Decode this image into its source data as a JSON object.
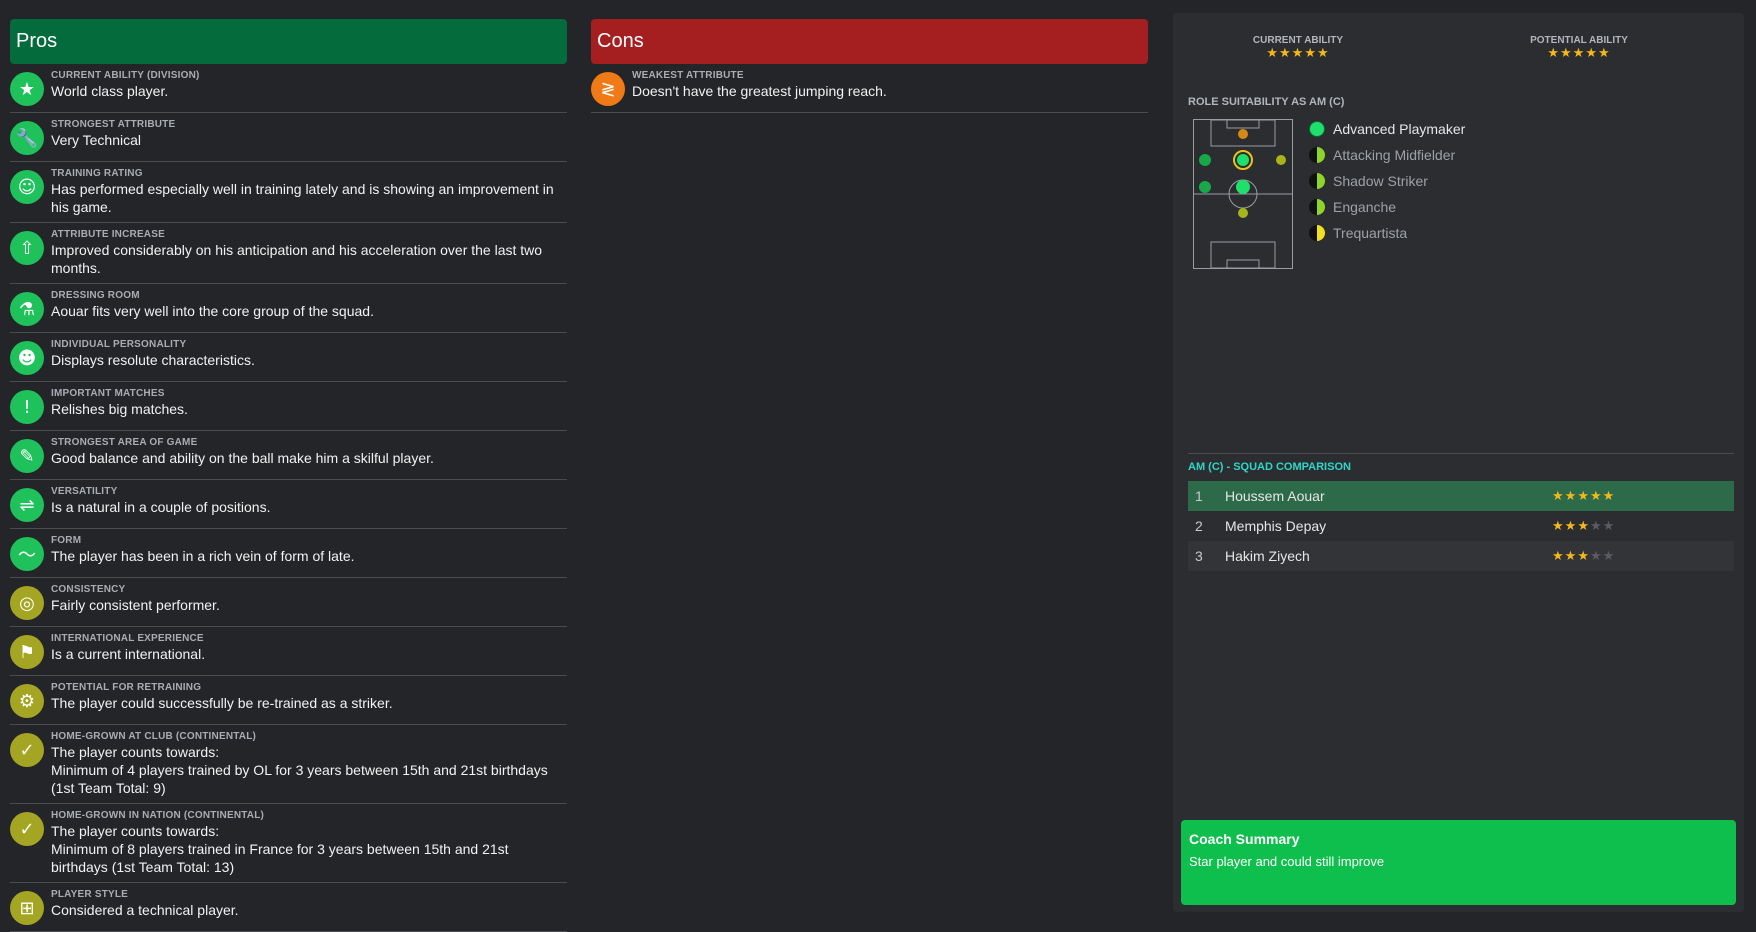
{
  "pros": {
    "title": "Pros",
    "items": [
      {
        "title": "CURRENT ABILITY (DIVISION)",
        "desc": "World class player."
      },
      {
        "title": "STRONGEST ATTRIBUTE",
        "desc": "Very Technical"
      },
      {
        "title": "TRAINING RATING",
        "desc": "Has performed especially well in training lately and is showing an improvement in his game."
      },
      {
        "title": "ATTRIBUTE INCREASE",
        "desc": "Improved considerably on his anticipation and his acceleration over the last two months."
      },
      {
        "title": "DRESSING ROOM",
        "desc": "Aouar fits very well into the core group of the squad."
      },
      {
        "title": "INDIVIDUAL PERSONALITY",
        "desc": "Displays resolute characteristics."
      },
      {
        "title": "IMPORTANT MATCHES",
        "desc": "Relishes big matches."
      },
      {
        "title": "STRONGEST AREA OF GAME",
        "desc": "Good balance and ability on the ball make him a skilful player."
      },
      {
        "title": "VERSATILITY",
        "desc": "Is a natural in a couple of positions."
      },
      {
        "title": "FORM",
        "desc": "The player has been in a rich vein of form of late."
      },
      {
        "title": "CONSISTENCY",
        "desc": "Fairly consistent performer."
      },
      {
        "title": "INTERNATIONAL EXPERIENCE",
        "desc": "Is a current international."
      },
      {
        "title": "POTENTIAL FOR RETRAINING",
        "desc": "The player could successfully be re-trained as a striker."
      },
      {
        "title": "HOME-GROWN AT CLUB (CONTINENTAL)",
        "desc": "The player counts towards:\nMinimum of 4 players trained by OL for 3 years between 15th and 21st birthdays (1st Team Total: 9)"
      },
      {
        "title": "HOME-GROWN IN NATION (CONTINENTAL)",
        "desc": "The player counts towards:\nMinimum of 8 players trained in France for 3 years between 15th and 21st birthdays (1st Team Total: 13)"
      },
      {
        "title": "PLAYER STYLE",
        "desc": "Considered a technical player."
      }
    ]
  },
  "cons": {
    "title": "Cons",
    "items": [
      {
        "title": "WEAKEST ATTRIBUTE",
        "desc": "Doesn't have the greatest jumping reach."
      }
    ]
  },
  "abilities": {
    "current_label": "CURRENT ABILITY",
    "current_stars": 5,
    "potential_label": "POTENTIAL ABILITY",
    "potential_stars": 5
  },
  "role_suitability": {
    "label": "ROLE SUITABILITY AS AM (C)",
    "roles": [
      {
        "name": "Advanced Playmaker",
        "rating": "full"
      },
      {
        "name": "Attacking Midfielder",
        "rating": "half-green"
      },
      {
        "name": "Shadow Striker",
        "rating": "half-green"
      },
      {
        "name": "Enganche",
        "rating": "half-green"
      },
      {
        "name": "Trequartista",
        "rating": "half-yellow"
      }
    ]
  },
  "squad_comparison": {
    "label": "AM (C) - SQUAD COMPARISON",
    "rows": [
      {
        "rank": "1",
        "name": "Houssem Aouar",
        "stars": 5
      },
      {
        "rank": "2",
        "name": "Memphis Depay",
        "stars": 3
      },
      {
        "rank": "3",
        "name": "Hakim Ziyech",
        "stars": 3
      }
    ]
  },
  "coach_summary": {
    "title": "Coach Summary",
    "text": "Star player and could still improve"
  },
  "colors": {
    "pros_header": "#046b3c",
    "cons_header": "#a51e20",
    "coach_bg": "#0fbf4d",
    "star": "#f3b81b"
  },
  "icons": {
    "pros": [
      "star-icon",
      "wrench-icon",
      "training-smile-icon",
      "training-arrow-icon",
      "flask-icon",
      "head-icon",
      "exclamation-ball-icon",
      "boot-icon",
      "handshake-icon",
      "trend-line-icon",
      "target-icon",
      "flag-icon",
      "retrain-gear-icon",
      "document-check-icon",
      "document-check-icon",
      "pitch-icon"
    ],
    "cons": [
      "spring-icon"
    ]
  }
}
